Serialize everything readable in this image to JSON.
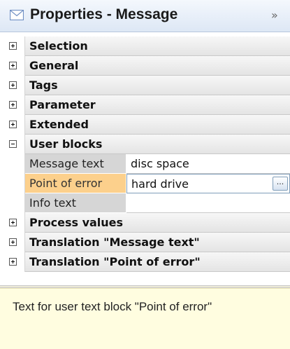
{
  "header": {
    "title": "Properties - Message",
    "icon": "envelope-icon",
    "collapse_glyph": "»"
  },
  "grid": {
    "categories": [
      {
        "label": "Selection",
        "state": "collapsed"
      },
      {
        "label": "General",
        "state": "collapsed"
      },
      {
        "label": "Tags",
        "state": "collapsed"
      },
      {
        "label": "Parameter",
        "state": "collapsed"
      },
      {
        "label": "Extended",
        "state": "collapsed"
      },
      {
        "label": "User blocks",
        "state": "expanded"
      },
      {
        "label": "Process values",
        "state": "collapsed"
      },
      {
        "label": "Translation \"Message text\"",
        "state": "collapsed"
      },
      {
        "label": "Translation \"Point of error\"",
        "state": "collapsed"
      }
    ],
    "user_blocks_props": [
      {
        "name": "Message text",
        "value": "disc space"
      },
      {
        "name": "Point of error",
        "value": "hard drive",
        "selected": true
      },
      {
        "name": "Info text",
        "value": ""
      }
    ],
    "ellipsis_label": "..."
  },
  "description": {
    "text": "Text for user text block \"Point of error\""
  },
  "colors": {
    "selected_name_bg": "#fcd08c",
    "description_bg": "#fffde0",
    "header_accent": "#6f8fc4"
  }
}
